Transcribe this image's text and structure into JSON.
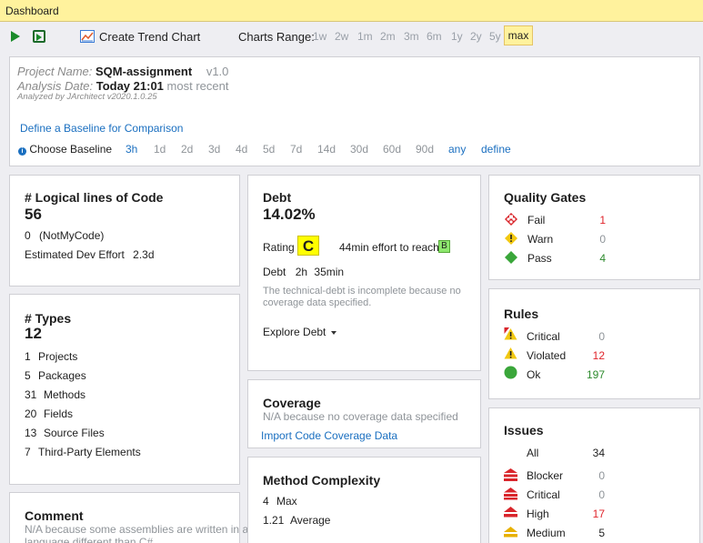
{
  "window": {
    "title": "Dashboard"
  },
  "toolbar": {
    "create_trend": "Create Trend Chart",
    "charts_range_label": "Charts Range:",
    "ranges": [
      "1w",
      "2w",
      "1m",
      "2m",
      "3m",
      "6m",
      "1y",
      "2y",
      "5y"
    ],
    "range_selected": "max"
  },
  "project": {
    "name_label": "Project Name:",
    "name": "SQM-assignment",
    "version": "v1.0",
    "date_label": "Analysis Date:",
    "date": "Today 21:01",
    "date_note": "most recent",
    "analyzed_by": "Analyzed by JArchitect v2020.1.0.25",
    "baseline_link": "Define a Baseline for Comparison",
    "choose_baseline": "Choose Baseline",
    "baseline_options": [
      "3h",
      "1d",
      "2d",
      "3d",
      "4d",
      "5d",
      "7d",
      "14d",
      "30d",
      "60d",
      "90d",
      "any",
      "define"
    ]
  },
  "loc": {
    "title": "# Logical lines of Code",
    "value": "56",
    "notmycode_count": "0",
    "notmycode_label": "(NotMyCode)",
    "effort_label": "Estimated Dev Effort",
    "effort_value": "2.3d"
  },
  "types": {
    "title": "# Types",
    "value": "12",
    "rows": [
      {
        "n": "1",
        "label": "Projects"
      },
      {
        "n": "5",
        "label": "Packages"
      },
      {
        "n": "31",
        "label": "Methods"
      },
      {
        "n": "20",
        "label": "Fields"
      },
      {
        "n": "13",
        "label": "Source Files"
      },
      {
        "n": "7",
        "label": "Third-Party Elements"
      }
    ]
  },
  "comment": {
    "title": "Comment",
    "note_line1": "N/A because some assemblies are written in a",
    "note_line2": "language different than C#"
  },
  "debt": {
    "title": "Debt",
    "value": "14.02%",
    "rating_label": "Rating",
    "rating": "C",
    "rating_color": "#ffff00",
    "effort_text": "44min effort to reach",
    "target_rating": "B",
    "target_color": "#8ee86e",
    "debt_label": "Debt",
    "debt_hours": "2h",
    "debt_minutes": "35min",
    "incomplete_line1": "The technical-debt is incomplete because no",
    "incomplete_line2": "coverage data specified.",
    "explore": "Explore Debt"
  },
  "coverage": {
    "title": "Coverage",
    "note": "N/A because no coverage data specified",
    "import_link": "Import Code Coverage Data"
  },
  "complexity": {
    "title": "Method Complexity",
    "rows": [
      {
        "n": "4",
        "label": "Max"
      },
      {
        "n": "1.21",
        "label": "Average"
      }
    ]
  },
  "quality_gates": {
    "title": "Quality Gates",
    "rows": [
      {
        "label": "Fail",
        "value": "1",
        "color": "#e0242b"
      },
      {
        "label": "Warn",
        "value": "0",
        "color": "#8f9499"
      },
      {
        "label": "Pass",
        "value": "4",
        "color": "#2e8b2e"
      }
    ]
  },
  "rules": {
    "title": "Rules",
    "rows": [
      {
        "label": "Critical",
        "value": "0",
        "color": "#8f9499"
      },
      {
        "label": "Violated",
        "value": "12",
        "color": "#e0242b"
      },
      {
        "label": "Ok",
        "value": "197",
        "color": "#2e8b2e"
      }
    ]
  },
  "issues": {
    "title": "Issues",
    "all_label": "All",
    "all_value": "34",
    "rows": [
      {
        "label": "Blocker",
        "value": "0",
        "color": "#8f9499"
      },
      {
        "label": "Critical",
        "value": "0",
        "color": "#8f9499"
      },
      {
        "label": "High",
        "value": "17",
        "color": "#e0242b"
      },
      {
        "label": "Medium",
        "value": "5",
        "color": "#1e1e1e"
      }
    ]
  }
}
